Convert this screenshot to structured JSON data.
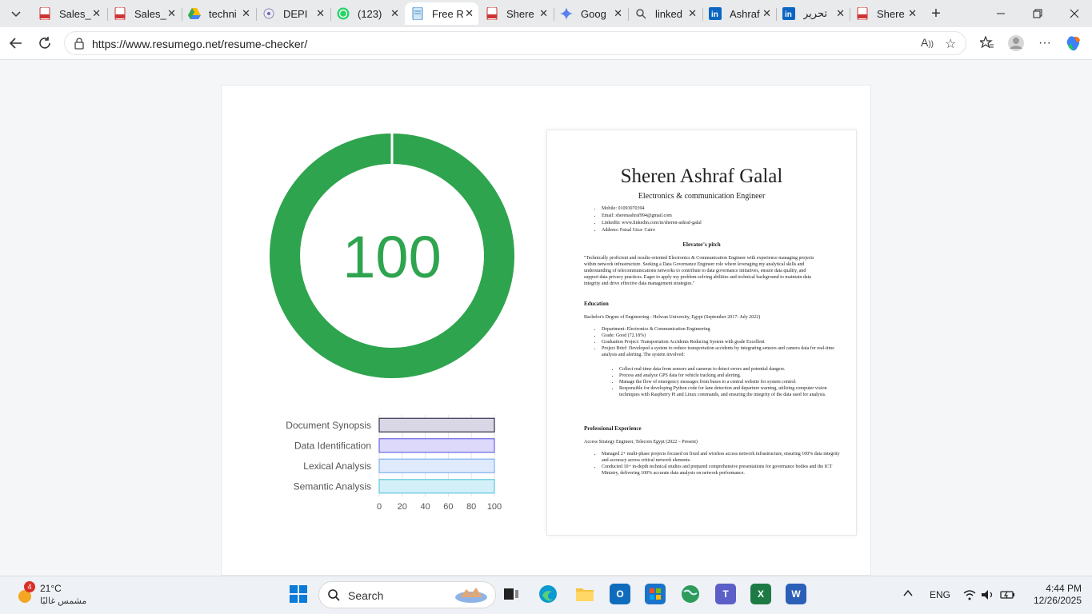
{
  "tabs": [
    {
      "label": "Sales_",
      "icon": "pdf-icon"
    },
    {
      "label": "Sales_",
      "icon": "pdf-icon"
    },
    {
      "label": "techni",
      "icon": "drive-icon"
    },
    {
      "label": "DEPI",
      "icon": "depi-icon"
    },
    {
      "label": "(123)",
      "icon": "whatsapp-icon"
    },
    {
      "label": "Free R",
      "icon": "resumego-icon",
      "active": true
    },
    {
      "label": "Shere",
      "icon": "pdf-icon"
    },
    {
      "label": "Goog",
      "icon": "gemini-icon"
    },
    {
      "label": "linked",
      "icon": "search-icon"
    },
    {
      "label": "Ashraf",
      "icon": "linkedin-icon"
    },
    {
      "label": "تحرير",
      "icon": "linkedin-icon"
    },
    {
      "label": "Shere",
      "icon": "pdf-icon"
    }
  ],
  "address": {
    "url": "https://www.resumego.net/resume-checker/"
  },
  "score": {
    "value": "100",
    "percent": 100,
    "color": "#2ea44f"
  },
  "chart_data": {
    "type": "bar",
    "orientation": "horizontal",
    "categories": [
      "Document Synopsis",
      "Data Identification",
      "Lexical Analysis",
      "Semantic Analysis"
    ],
    "values": [
      100,
      100,
      100,
      100
    ],
    "xticks": [
      "0",
      "20",
      "40",
      "60",
      "80",
      "100"
    ],
    "xlim": [
      0,
      100
    ],
    "colors": [
      "#d9d6e6",
      "#dcd9fb",
      "#dfeafc",
      "#d3f0f8"
    ],
    "borders": [
      "#33334a",
      "#6a64e6",
      "#7fb0ee",
      "#5ec9e0"
    ]
  },
  "resume": {
    "name": "Sheren Ashraf Galal",
    "title": "Electronics & communication Engineer",
    "contact": [
      "Mobile: 01093070394",
      "Email: sherenashraf994@gmail.com",
      "LinkedIn: www.linkedin.com/in/sheren-ashraf-galal",
      "Address: Faisal Giza- Cairo"
    ],
    "pitch_heading": "Elevator's pitch",
    "pitch": "\"Technically proficient and results-oriented Electronics & Communication Engineer with experience managing projects within network infrastructure. Seeking a Data Governance Engineer role where leveraging my analytical skills and understanding of telecommunications networks to contribute to data governance initiatives, ensure data quality, and support data privacy practices. Eager to apply my problem-solving abilities and technical background to maintain data integrity and drive effective data management strategies.\"",
    "education_heading": "Education",
    "degree": "Bachelor's Degree of Engineering - Helwan University, Egypt (September 2017- July 2022)",
    "education_items": [
      "Department: Electronics & Communication Engineering",
      "Grade: Good (72.18%)",
      "Graduation Project: Transportation Accidents Reducing System with grade Excellent",
      "Project Brief: Developed a system to reduce transportation accidents by integrating sensors and camera data for real-time analysis and alerting. The system involved:"
    ],
    "project_items": [
      "Collect real-time data from sensors and cameras to detect errors and potential dangers.",
      "Process and analyze GPS data for vehicle tracking and alerting.",
      "Manage the flow of emergency messages from buses to a central website for system control.",
      "Responsible for developing Python code for lane detection and departure warning, utilizing computer vision techniques with Raspberry Pi and Linux commands, and ensuring the integrity of the data used for analysis."
    ],
    "experience_heading": "Professional Experience",
    "job": "Access Strategy Engineer, Telecom Egypt (2022 – Present)",
    "experience_items": [
      "Managed 2+ multi-phase projects focused on fixed and wireless access network infrastructure, ensuring 100% data integrity and accuracy across critical network elements.",
      "Conducted 10+ in-depth technical studies and prepared comprehensive presentations for governance bodies and the ICT Ministry, delivering 100% accurate data analysis on network performance."
    ]
  },
  "taskbar": {
    "weather_temp": "21°C",
    "weather_desc": "مشمس غالبًا",
    "weather_badge": "4",
    "search_label": "Search",
    "lang": "ENG",
    "time": "4:44 PM",
    "date": "12/26/2025"
  }
}
